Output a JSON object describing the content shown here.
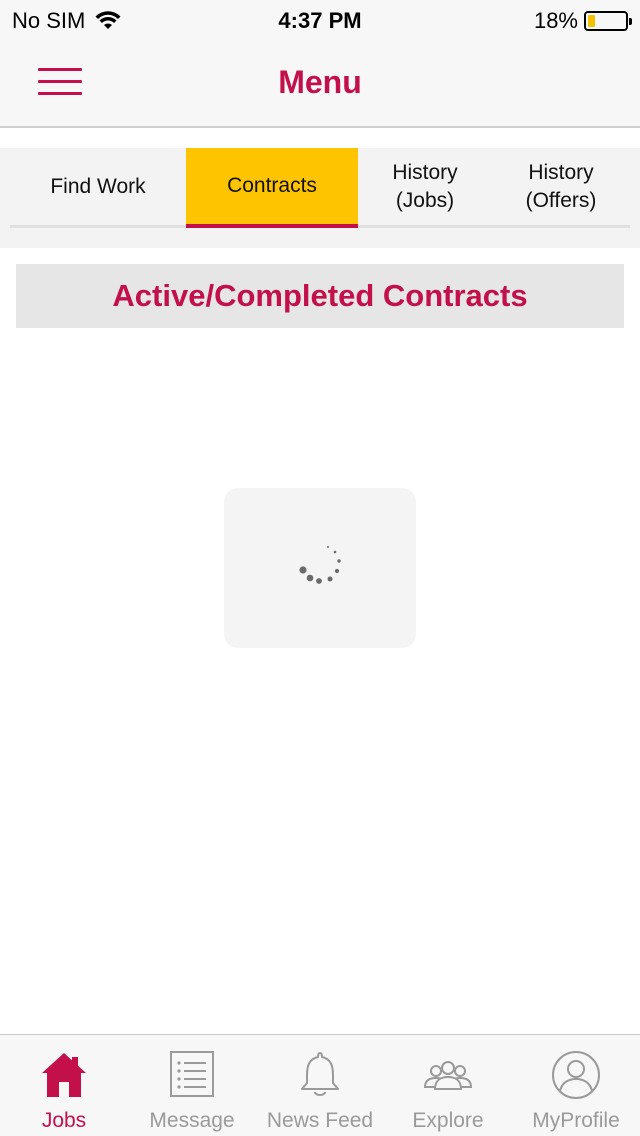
{
  "status_bar": {
    "carrier": "No SIM",
    "time": "4:37 PM",
    "battery": "18%",
    "battery_level": 0.18
  },
  "nav": {
    "title": "Menu",
    "menu_icon": "hamburger-icon"
  },
  "tabs": [
    {
      "label": "Find Work"
    },
    {
      "label": "Contracts"
    },
    {
      "line1": "History",
      "line2": "(Jobs)"
    },
    {
      "line1": "History",
      "line2": "(Offers)"
    }
  ],
  "section": {
    "title": "Active/Completed Contracts"
  },
  "tab_bar": {
    "items": [
      {
        "label": "Jobs",
        "icon": "home-icon"
      },
      {
        "label": "Message",
        "icon": "list-icon"
      },
      {
        "label": "News Feed",
        "icon": "bell-icon"
      },
      {
        "label": "Explore",
        "icon": "people-icon"
      },
      {
        "label": "MyProfile",
        "icon": "profile-icon"
      }
    ]
  },
  "colors": {
    "accent": "#c4104a",
    "tab_active_bg": "#ffc400",
    "inactive": "#9a9a9a"
  }
}
